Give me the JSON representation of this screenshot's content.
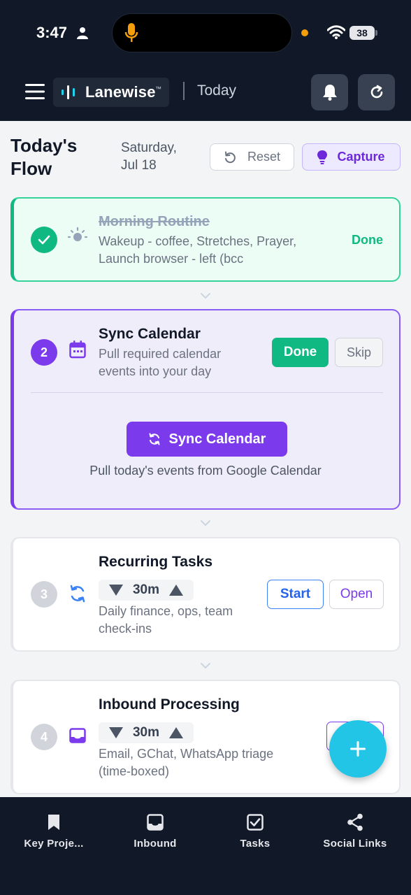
{
  "status_bar": {
    "time": "3:47",
    "battery": "38"
  },
  "header": {
    "app_name": "Lanewise",
    "trademark": "™",
    "title": "Today"
  },
  "page": {
    "title": "Today's Flow",
    "date_line1": "Saturday,",
    "date_line2": "Jul 18",
    "reset_label": "Reset",
    "capture_label": "Capture"
  },
  "steps": [
    {
      "title": "Morning Routine",
      "desc": "Wakeup - coffee, Stretches, Prayer, Launch browser - left (bcc",
      "status_label": "Done"
    },
    {
      "number": "2",
      "title": "Sync Calendar",
      "desc": "Pull required calendar events into your day",
      "done_label": "Done",
      "skip_label": "Skip",
      "action_label": "Sync Calendar",
      "action_note": "Pull today's events from Google Calendar"
    },
    {
      "number": "3",
      "title": "Recurring Tasks",
      "duration": "30m",
      "desc": "Daily finance, ops, team check-ins",
      "start_label": "Start",
      "open_label": "Open"
    },
    {
      "number": "4",
      "title": "Inbound Processing",
      "duration": "30m",
      "desc": "Email, GChat, WhatsApp triage (time-boxed)"
    }
  ],
  "bottom_nav": [
    {
      "label": "Key Proje...",
      "icon": "bookmark-icon"
    },
    {
      "label": "Inbound",
      "icon": "inbox-icon"
    },
    {
      "label": "Tasks",
      "icon": "checkbox-icon"
    },
    {
      "label": "Social Links",
      "icon": "share-icon"
    }
  ],
  "colors": {
    "accent": "#7c3aed",
    "success": "#10b981",
    "fab": "#22c5e6",
    "header_bg": "#111827"
  }
}
